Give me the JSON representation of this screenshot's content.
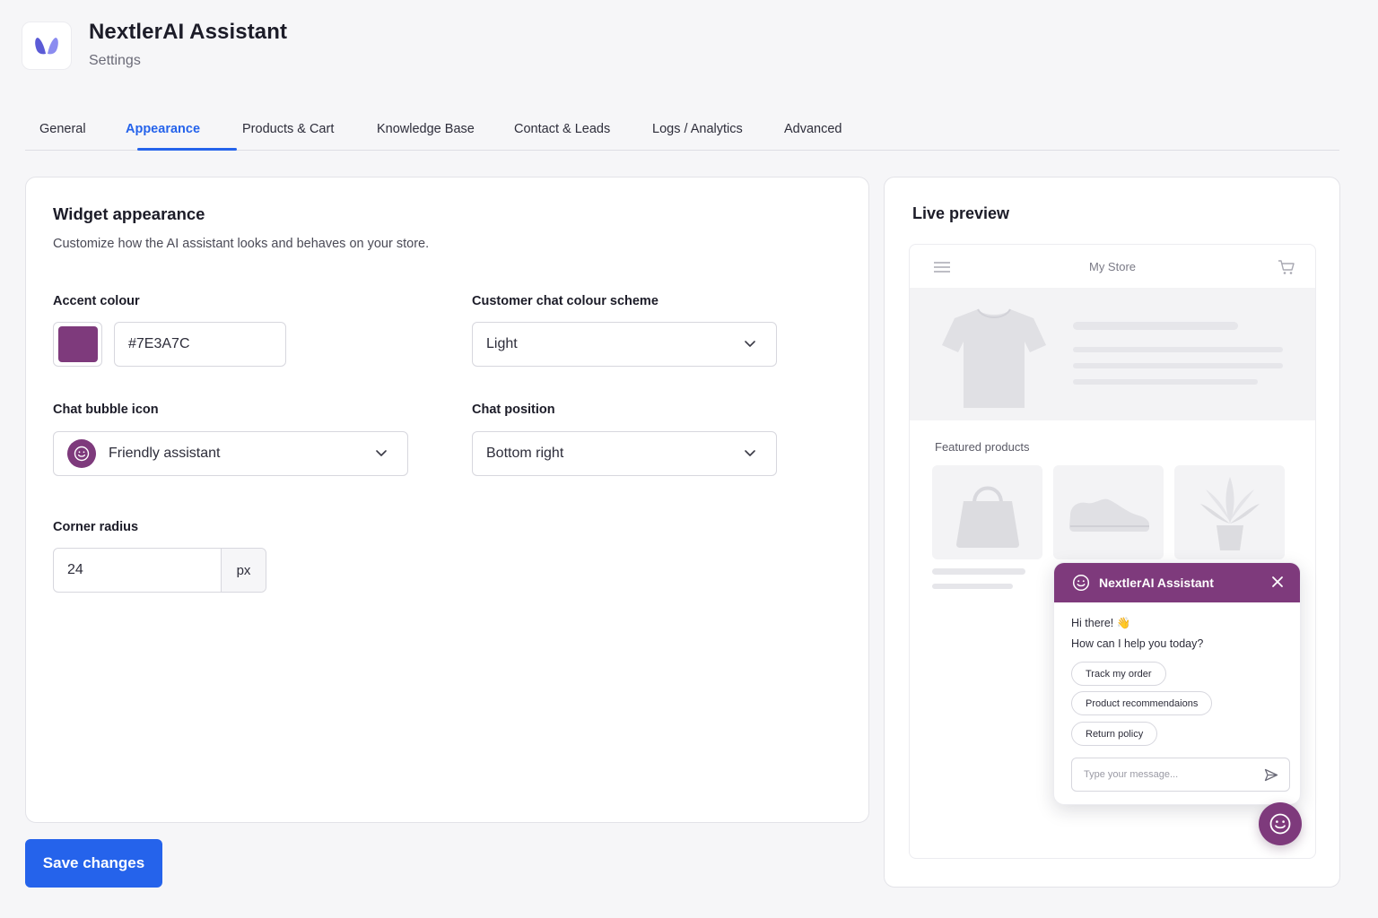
{
  "colors": {
    "accent": "#7E3A7C",
    "primary": "#2563eb",
    "logo": "#5b5bd6"
  },
  "app": {
    "title": "NextlerAI Assistant",
    "subtitle": "Settings",
    "logo_icon": "butterfly-logo-icon"
  },
  "tabs": [
    {
      "label": "General",
      "active": false
    },
    {
      "label": "Appearance",
      "active": true
    },
    {
      "label": "Products & Cart",
      "active": false
    },
    {
      "label": "Knowledge Base",
      "active": false
    },
    {
      "label": "Contact & Leads",
      "active": false
    },
    {
      "label": "Logs / Analytics",
      "active": false
    },
    {
      "label": "Advanced",
      "active": false
    }
  ],
  "appearance": {
    "title": "Widget appearance",
    "description": "Customize how the AI assistant looks and behaves on your store.",
    "accent_label": "Accent colour",
    "accent_value": "#7E3A7C",
    "scheme_label": "Customer chat colour scheme",
    "scheme_value": "Light",
    "bubble_label": "Chat bubble icon",
    "bubble_value": "Friendly assistant",
    "position_label": "Chat position",
    "position_value": "Bottom right",
    "radius_label": "Corner radius",
    "radius_value": "24",
    "radius_unit": "px"
  },
  "save_label": "Save changes",
  "preview": {
    "title": "Live preview",
    "store_name": "My Store",
    "featured_label": "Featured products",
    "chat": {
      "title": "NextlerAI Assistant",
      "greeting": "Hi there! 👋",
      "question": "How can I help you today?",
      "chips": [
        "Track my order",
        "Product recommendaions",
        "Return policy"
      ],
      "placeholder": "Type your message..."
    }
  }
}
